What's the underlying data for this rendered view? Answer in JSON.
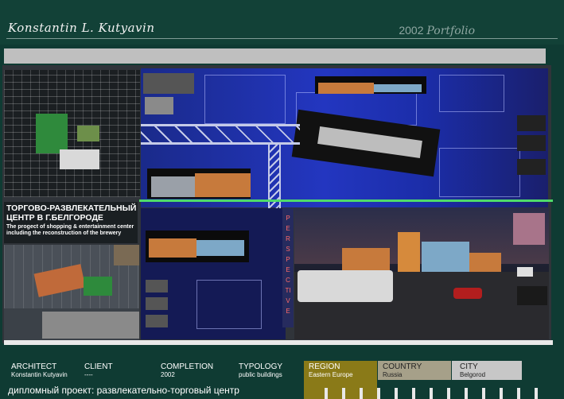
{
  "header": {
    "author": "Konstantin L. Kutyavin",
    "year": "2002",
    "portfolio_word": "Portfolio"
  },
  "project": {
    "title_ru": "Торгово-развлекательный центр в г.Белгороде",
    "title_en": "The progect of shopping & entertainment center including the reconstruction of the brewery",
    "vertical_label": "PERSPECTIVE"
  },
  "info": {
    "architect_label": "ARCHITECT",
    "architect_value": "Konstantin Kutyavin",
    "client_label": "CLIENT",
    "client_value": "----",
    "completion_label": "COMPLETION",
    "completion_value": "2002",
    "typology_label": "TYPOLOGY",
    "typology_value": "public buildings",
    "region_label": "REGION",
    "region_value": "Eastern Europe",
    "country_label": "COUNTRY",
    "country_value": "Russia",
    "city_label": "CITY",
    "city_value": "Belgorod"
  },
  "footer": {
    "caption": "дипломный проект:  развлекательно-торговый центр"
  },
  "colors": {
    "background": "#0f3b33",
    "sheet_blue": "#2336c0",
    "region": "#8a7a18",
    "country": "#a6a089",
    "city": "#c7c7c7"
  }
}
